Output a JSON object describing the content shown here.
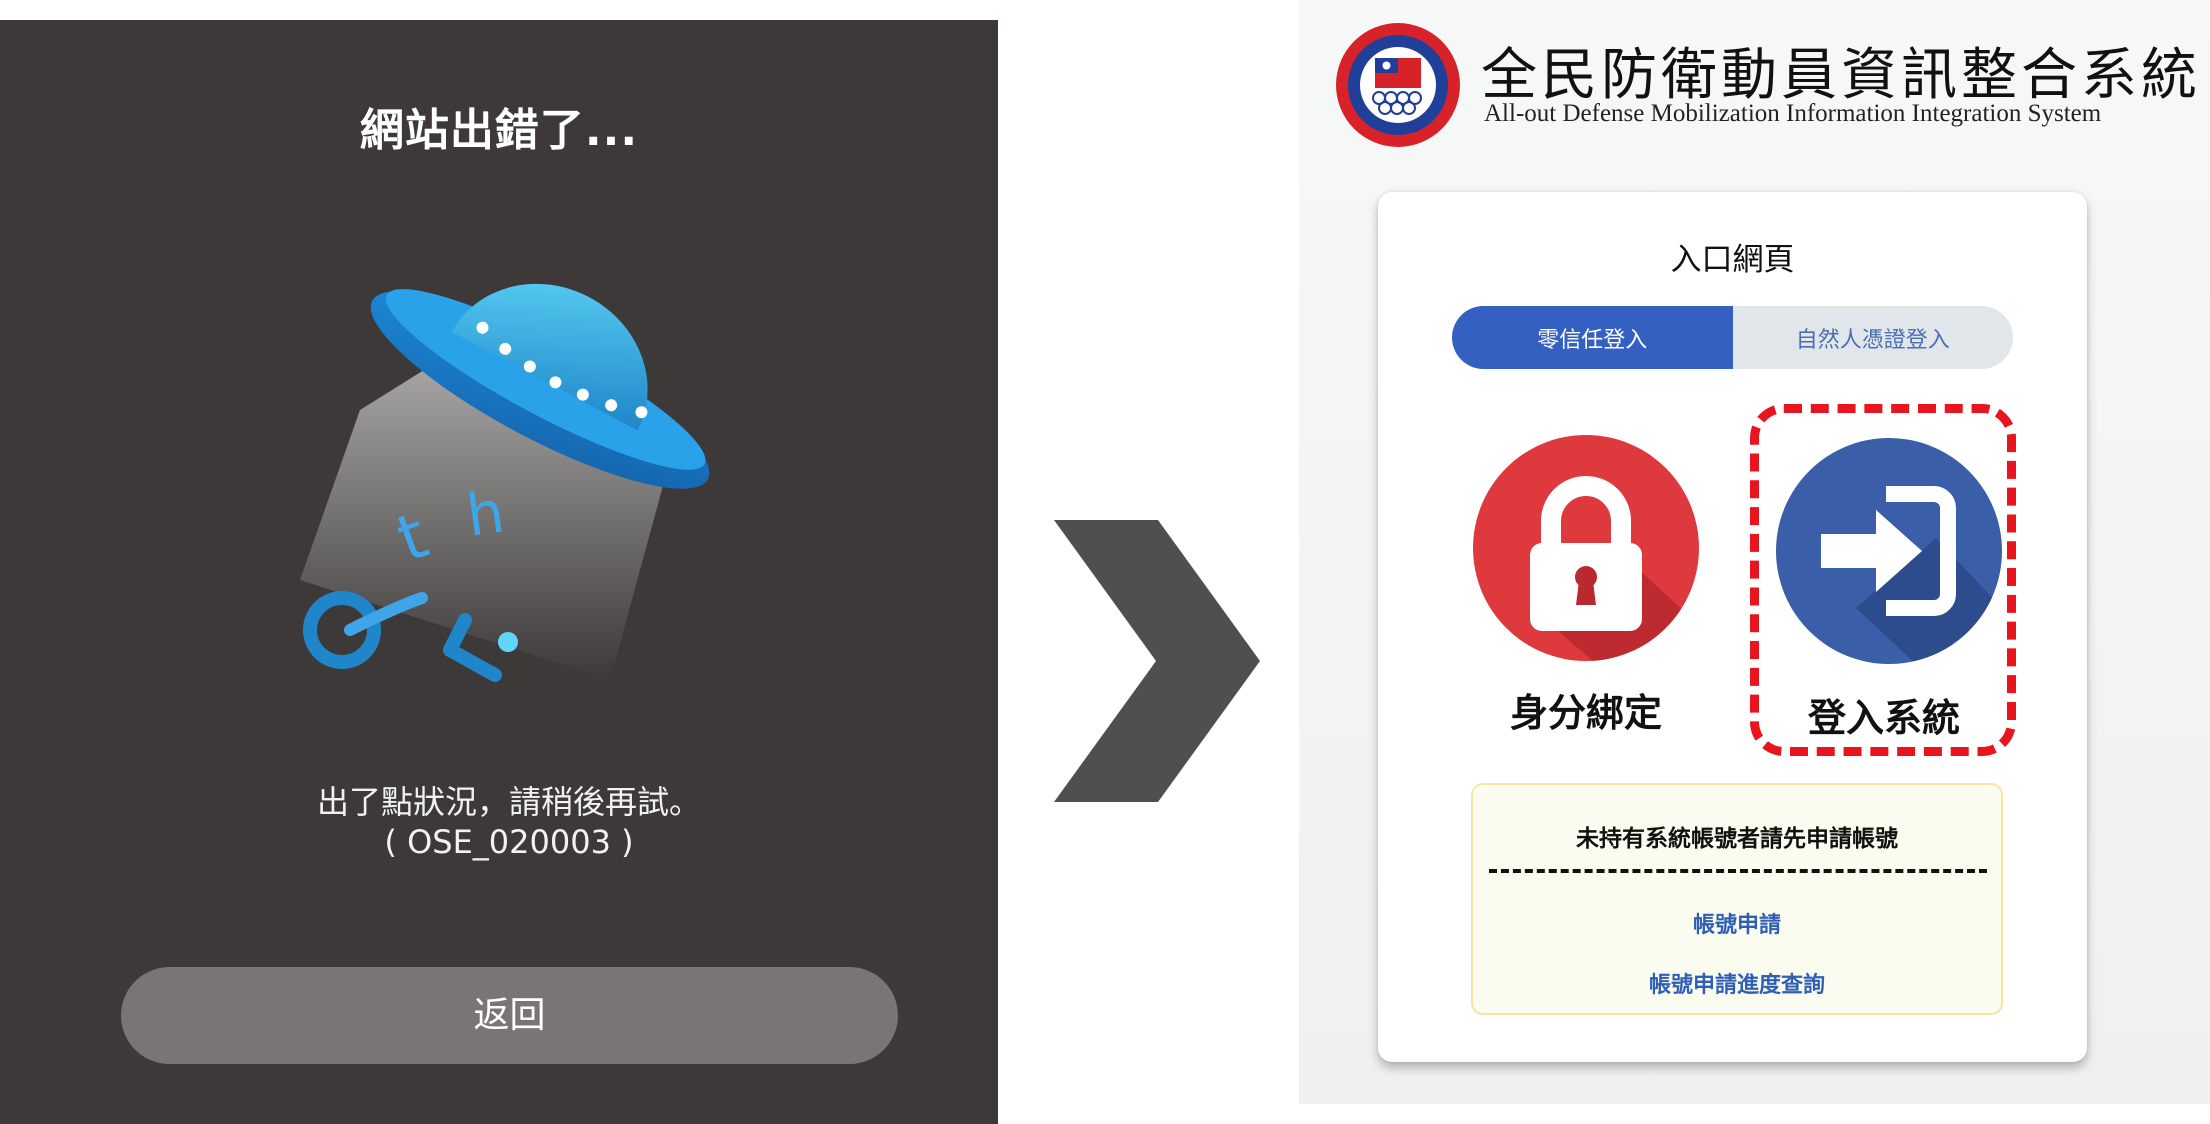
{
  "error_page": {
    "title": "網站出錯了...",
    "message": "出了點狀況，請稍後再試。",
    "code": "( OSE_020003 )",
    "back_button": "返回",
    "illustration": "ufo-icon"
  },
  "transition": {
    "icon": "chevron-right-icon"
  },
  "login_page": {
    "title_zh": "全民防衛動員資訊整合系統",
    "title_en": "All-out Defense Mobilization Information Integration System",
    "card": {
      "title": "入口網頁",
      "tabs": [
        {
          "label": "零信任登入",
          "active": true
        },
        {
          "label": "自然人憑證登入",
          "active": false
        }
      ],
      "actions": [
        {
          "label": "身分綁定",
          "icon": "lock-icon",
          "color": "#de3a3e"
        },
        {
          "label": "登入系統",
          "icon": "sign-in-icon",
          "color": "#3b5ea8"
        }
      ],
      "account": {
        "notice": "未持有系統帳號者請先申請帳號",
        "links": [
          "帳號申請",
          "帳號申請進度查詢"
        ]
      }
    }
  },
  "colors": {
    "error_background": "#3d3939",
    "back_button": "#7a7574",
    "tab_active": "#3461c1",
    "highlight": "#e8141e"
  }
}
